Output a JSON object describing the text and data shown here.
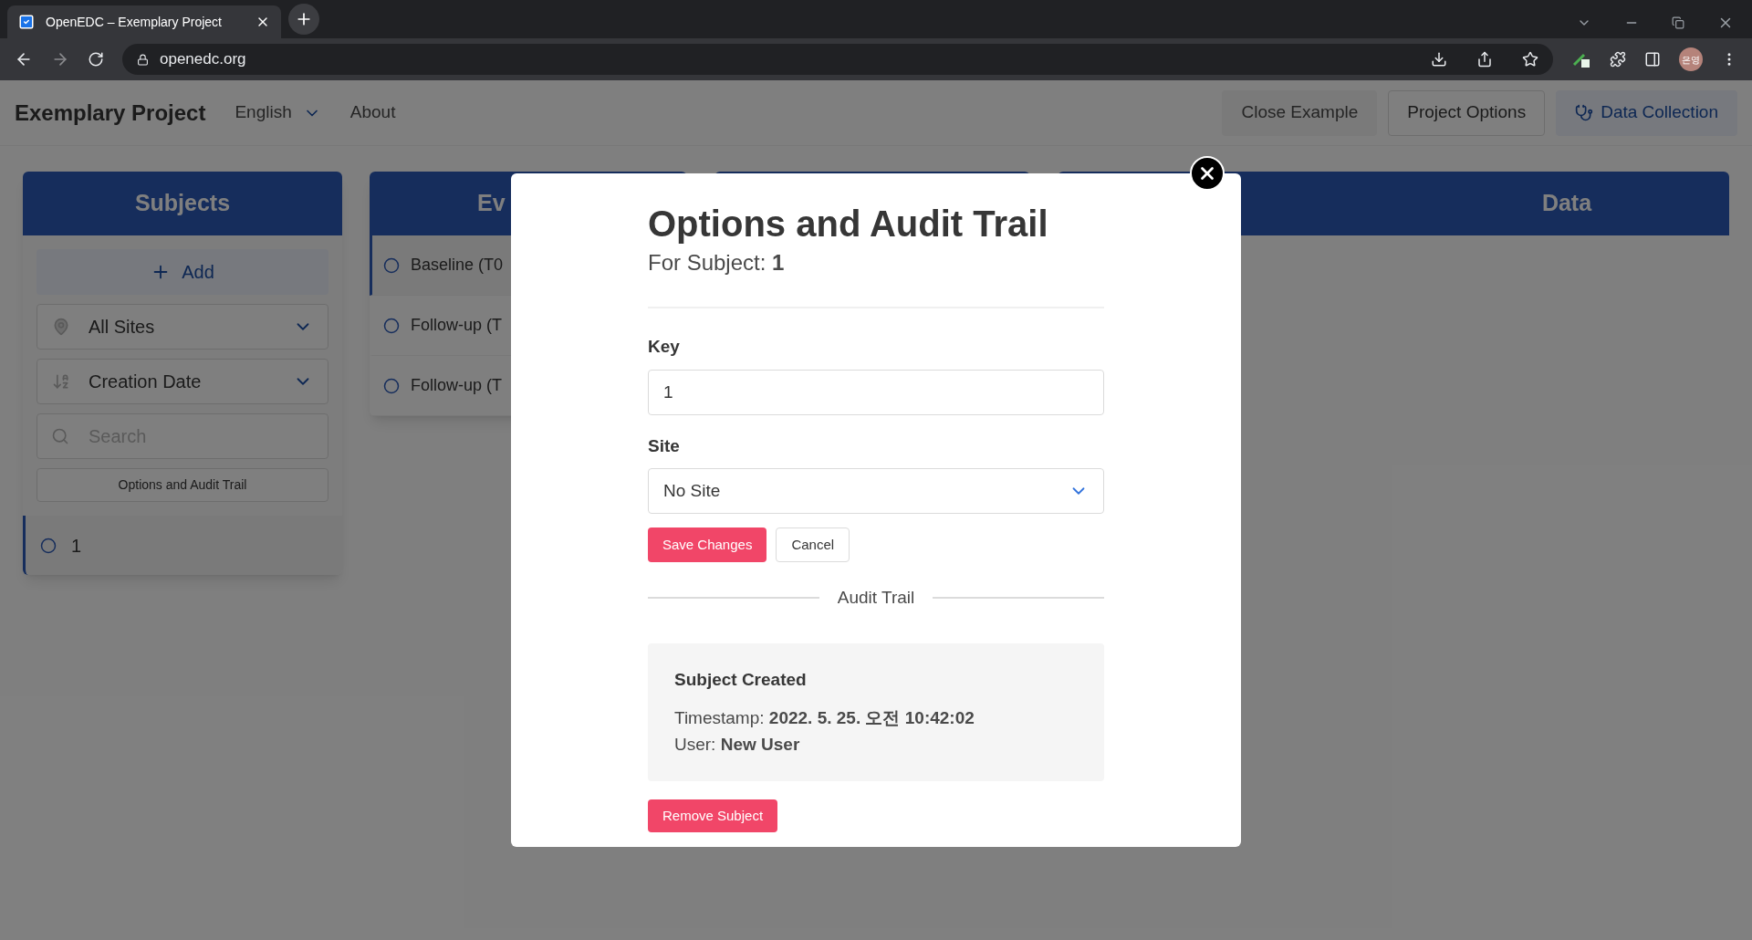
{
  "browser": {
    "tab_title": "OpenEDC – Exemplary Project",
    "url": "openedc.org",
    "profile_initials": "은영"
  },
  "header": {
    "project_title": "Exemplary Project",
    "language": "English",
    "about": "About",
    "buttons": [
      {
        "label": "Close Example",
        "kind": "plain"
      },
      {
        "label": "Project Options",
        "kind": "outline"
      },
      {
        "label": "Data Collection",
        "kind": "primary"
      }
    ]
  },
  "subjects_panel": {
    "title": "Subjects",
    "add_label": "Add",
    "site_filter": "All Sites",
    "sort": "Creation Date",
    "search_placeholder": "Search",
    "audit_button": "Options and Audit Trail",
    "subjects": [
      {
        "key": "1",
        "selected": true
      }
    ]
  },
  "events_panel": {
    "title": "Ev",
    "events": [
      {
        "label": "Baseline (T0",
        "selected": true
      },
      {
        "label": "Follow-up (T",
        "selected": false
      },
      {
        "label": "Follow-up (T",
        "selected": false
      }
    ]
  },
  "data_panel": {
    "title": "Data"
  },
  "modal": {
    "title": "Options and Audit Trail",
    "subtitle": "For Subject: **1**",
    "key_label": "Key",
    "key_value": "1",
    "site_label": "Site",
    "site_value": "No Site",
    "save_label": "Save Changes",
    "cancel_label": "Cancel",
    "audit_heading": "Audit Trail",
    "audit_entries": [
      {
        "title": "Subject Created",
        "timestamp_line": "Timestamp: **2022. 5. 25. 오전 10:42:02**",
        "user_line": "User: **New User**"
      }
    ],
    "remove_label": "Remove Subject"
  }
}
